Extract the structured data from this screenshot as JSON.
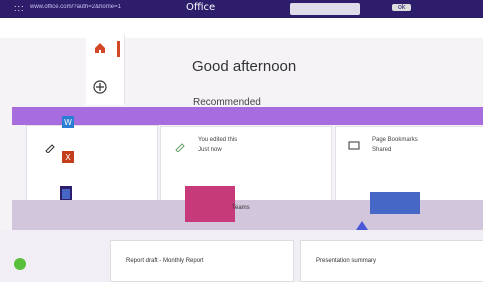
{
  "topbar": {
    "apps_glyph": ":::",
    "address_text": "www.office.com/?auth=2&home=1",
    "brand": "Office",
    "user_text": "ok"
  },
  "main": {
    "greeting": "Good afternoon",
    "recommended_label": "Recommended"
  },
  "cards": [
    {
      "line1": "You edited this",
      "line2": "Just now"
    },
    {
      "line1": "Page Bookmarks",
      "line2": "Shared"
    }
  ],
  "bottom": {
    "tile1_text": "Report draft - Monthly Report",
    "tile2_text": "Presentation summary"
  },
  "pink_box_text": "Teams",
  "colors": {
    "topbar": "#2d1d6b",
    "purple_band": "#a76ddf",
    "accent": "#d24726",
    "pink": "#c63a7a",
    "blue": "#4667c6",
    "green": "#5abf3a"
  }
}
